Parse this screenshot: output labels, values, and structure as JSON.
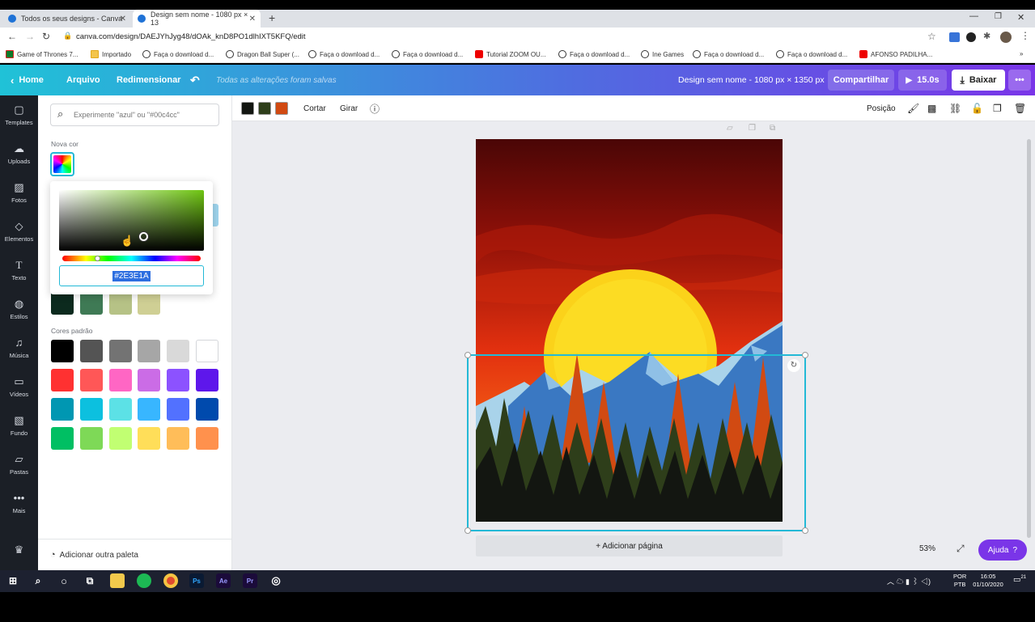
{
  "browser": {
    "tabs": [
      {
        "title": "Todos os seus designs - Canva"
      },
      {
        "title": "Design sem nome - 1080 px × 13"
      }
    ],
    "url": "canva.com/design/DAEJYhJyg48/dOAk_knD8PO1dlhIXT5KFQ/edit",
    "bookmarks": [
      "Game of Thrones 7...",
      "Importado",
      "Faça o download d...",
      "Dragon Ball Super (...",
      "Faça o download d...",
      "Faça o download d...",
      "Tutorial ZOOM OU...",
      "Faça o download d...",
      "Ine Games",
      "Faça o download d...",
      "Faça o download d...",
      "AFONSO PADILHA..."
    ]
  },
  "header": {
    "home": "Home",
    "file": "Arquivo",
    "resize": "Redimensionar",
    "saved_status": "Todas as alterações foram salvas",
    "design_title": "Design sem nome - 1080 px × 1350 px",
    "share": "Compartilhar",
    "play_duration": "15.0s",
    "download": "Baixar"
  },
  "sidebar": {
    "items": [
      {
        "label": "Templates",
        "icon": "templates-icon"
      },
      {
        "label": "Uploads",
        "icon": "upload-icon"
      },
      {
        "label": "Fotos",
        "icon": "photos-icon"
      },
      {
        "label": "Elementos",
        "icon": "elements-icon"
      },
      {
        "label": "Texto",
        "icon": "text-icon"
      },
      {
        "label": "Estilos",
        "icon": "styles-icon"
      },
      {
        "label": "Música",
        "icon": "music-icon"
      },
      {
        "label": "Vídeos",
        "icon": "video-icon"
      },
      {
        "label": "Fundo",
        "icon": "background-icon"
      },
      {
        "label": "Pastas",
        "icon": "folder-icon"
      },
      {
        "label": "Mais",
        "icon": "more-icon"
      }
    ]
  },
  "color_panel": {
    "search_placeholder": "Experimente \"azul\" ou \"#00c4cc\"",
    "new_color_label": "Nova cor",
    "hex_value": "#2E3E1A",
    "photo_colors": [
      "#0c2a1e",
      "#3f7a55",
      "#b6c286",
      "#cfcf94"
    ],
    "default_colors_label": "Cores padrão",
    "default_colors": [
      "#000000",
      "#545454",
      "#737373",
      "#a6a6a6",
      "#d9d9d9",
      "#ffffff",
      "#ff3131",
      "#ff5757",
      "#ff66c4",
      "#cb6ce6",
      "#8c52ff",
      "#5e17eb",
      "#0097b2",
      "#0cc0df",
      "#5ce1e6",
      "#38b6ff",
      "#5271ff",
      "#004aad",
      "#00bf63",
      "#7ed957",
      "#c1ff72",
      "#ffde59",
      "#ffbd59",
      "#ff914d"
    ],
    "add_palette": "Adicionar outra paleta"
  },
  "toolbar": {
    "colors": [
      "#131611",
      "#2e3e1a",
      "#d14a12"
    ],
    "crop": "Cortar",
    "flip": "Girar",
    "position": "Posição"
  },
  "canvas": {
    "add_page": "+ Adicionar página",
    "zoom": "53%",
    "help": "Ajuda"
  },
  "taskbar": {
    "language_line1": "POR",
    "language_line2": "PTB",
    "time": "16:05",
    "date": "01/10/2020",
    "notifications": "21"
  }
}
